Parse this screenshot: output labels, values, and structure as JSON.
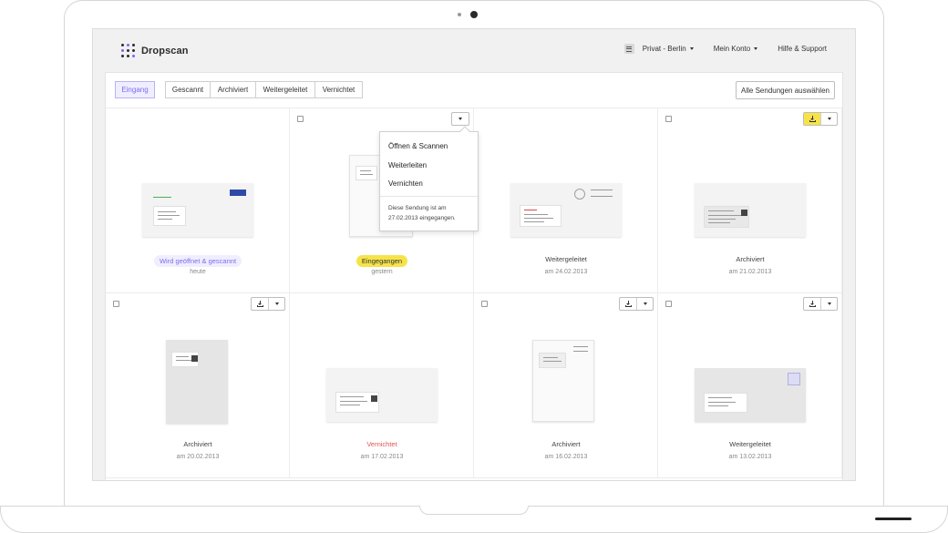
{
  "app": {
    "name": "Dropscan",
    "brand_color": "#8b5cf6"
  },
  "nav": {
    "account_selector": "Privat - Berlin",
    "my_account": "Mein Konto",
    "help": "Hilfe & Support"
  },
  "tabs": [
    {
      "label": "Eingang",
      "active": true
    },
    {
      "label": "Gescannt",
      "active": false
    },
    {
      "label": "Archiviert",
      "active": false
    },
    {
      "label": "Weitergeleitet",
      "active": false
    },
    {
      "label": "Vernichtet",
      "active": false
    }
  ],
  "select_all_label": "Alle Sendungen auswählen",
  "items": [
    {
      "status": "Wird geöffnet & gescannt",
      "status_style": "purple-pill",
      "date": "heute"
    },
    {
      "status": "Eingegangen",
      "status_style": "yellow-pill",
      "date": "gestern"
    },
    {
      "status": "Weitergeleitet",
      "status_style": "plain",
      "date": "am 24.02.2013"
    },
    {
      "status": "Archiviert",
      "status_style": "plain",
      "date": "am 21.02.2013"
    },
    {
      "status": "Archiviert",
      "status_style": "plain",
      "date": "am 20.02.2013"
    },
    {
      "status": "Vernichtet",
      "status_style": "red",
      "date": "am 17.02.2013"
    },
    {
      "status": "Archiviert",
      "status_style": "plain",
      "date": "am 16.02.2013"
    },
    {
      "status": "Weitergeleitet",
      "status_style": "plain",
      "date": "am 13.02.2013"
    }
  ],
  "dropdown": {
    "items": [
      "Öffnen & Scannen",
      "Weiterleiten",
      "Vernichten"
    ],
    "note": "Diese Sendung ist am 27.02.2013 eingegangen."
  },
  "colors": {
    "accent": "#7c6cf0",
    "yellow": "#f6e34a",
    "destroyed": "#e05555"
  }
}
